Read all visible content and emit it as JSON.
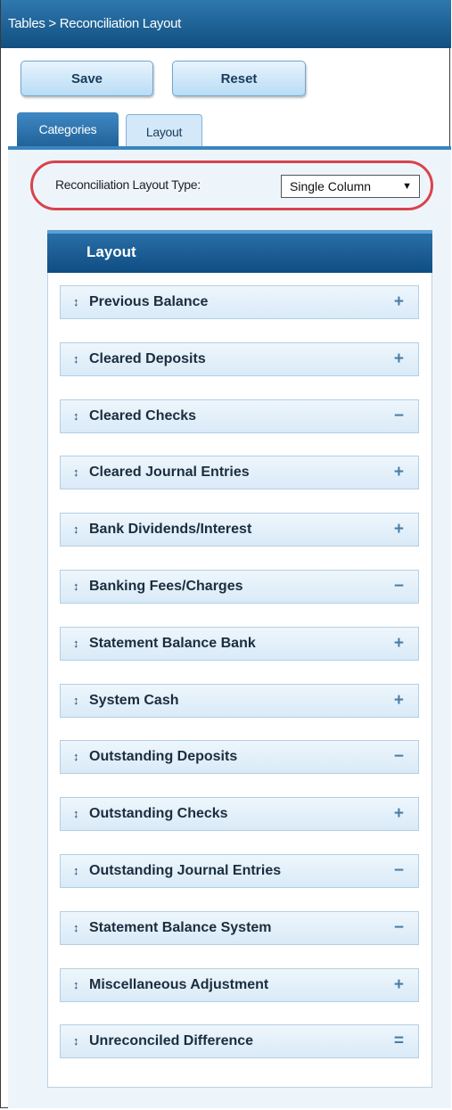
{
  "breadcrumb": "Tables > Reconciliation Layout",
  "toolbar": {
    "save_label": "Save",
    "reset_label": "Reset"
  },
  "tabs": [
    {
      "label": "Categories",
      "active": false
    },
    {
      "label": "Layout",
      "active": true
    }
  ],
  "layout_type": {
    "label": "Reconciliation Layout Type:",
    "selected": "Single Column"
  },
  "layout_panel": {
    "title": "Layout",
    "rows": [
      {
        "label": "Previous Balance",
        "control": "+"
      },
      {
        "label": "Cleared Deposits",
        "control": "+"
      },
      {
        "label": "Cleared Checks",
        "control": "−"
      },
      {
        "label": "Cleared Journal Entries",
        "control": "+"
      },
      {
        "label": "Bank Dividends/Interest",
        "control": "+"
      },
      {
        "label": "Banking Fees/Charges",
        "control": "−"
      },
      {
        "label": "Statement Balance Bank",
        "control": "+"
      },
      {
        "label": "System Cash",
        "control": "+"
      },
      {
        "label": "Outstanding Deposits",
        "control": "−"
      },
      {
        "label": "Outstanding Checks",
        "control": "+"
      },
      {
        "label": "Outstanding Journal Entries",
        "control": "−"
      },
      {
        "label": "Statement Balance System",
        "control": "−"
      },
      {
        "label": "Miscellaneous Adjustment",
        "control": "+"
      },
      {
        "label": "Unreconciled Difference",
        "control": "="
      }
    ]
  },
  "colors": {
    "accent": "#1a5e94",
    "highlight_oval": "#d9434b"
  },
  "icons": {
    "drag_handle": "updown-arrow-icon",
    "add": "plus-icon",
    "remove": "minus-icon",
    "equals": "equals-icon"
  }
}
